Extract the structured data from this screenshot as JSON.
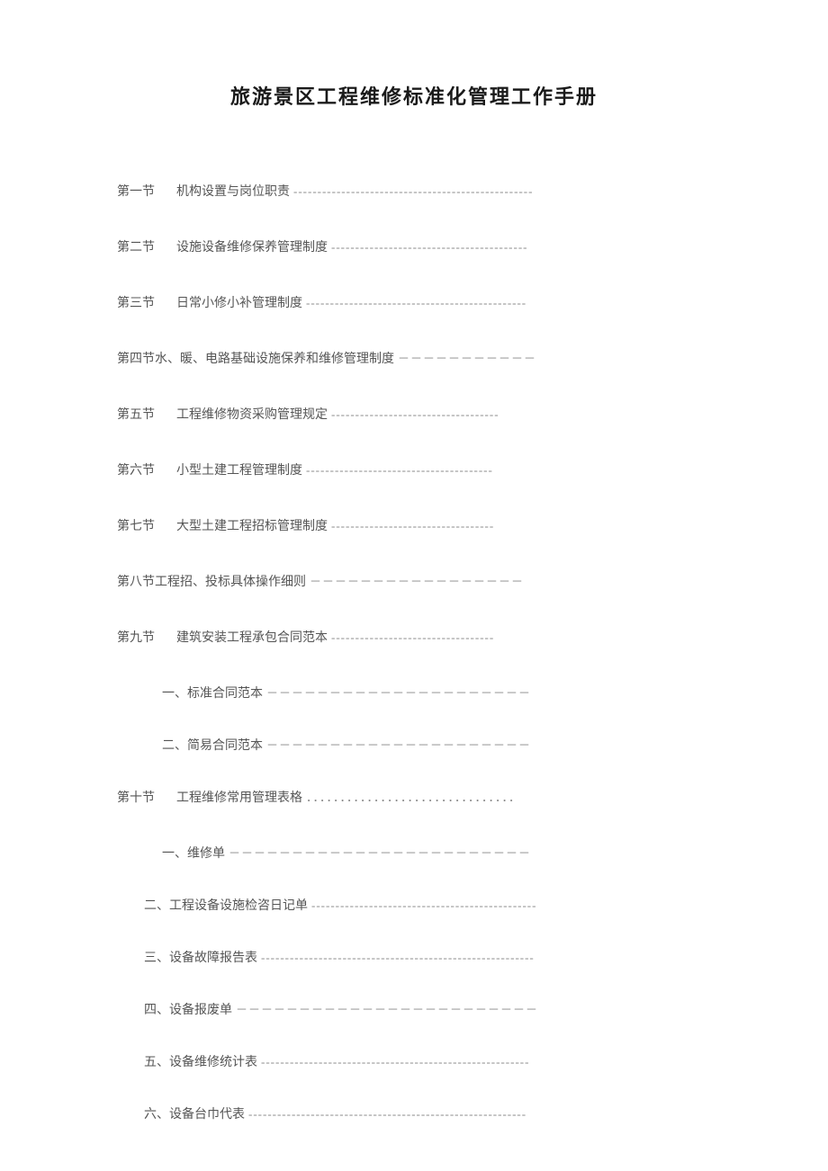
{
  "title": "旅游景区工程维修标准化管理工作手册",
  "toc": {
    "s1": {
      "label": "第一节",
      "text": "机构设置与岗位职责",
      "leader": "--------------------------------------------------"
    },
    "s2": {
      "label": "第二节",
      "text": "设施设备维修保养管理制度",
      "leader": "-----------------------------------------"
    },
    "s3": {
      "label": "第三节",
      "text": "日常小修小补管理制度",
      "leader": "----------------------------------------------"
    },
    "s4": {
      "label": "第四节",
      "text": "水、暖、电路基础设施保养和维修管理制度",
      "leader": "－－－－－－－－－－－"
    },
    "s5": {
      "label": "第五节",
      "text": "工程维修物资采购管理规定",
      "leader": "-----------------------------------"
    },
    "s6": {
      "label": "第六节",
      "text": "小型土建工程管理制度",
      "leader": "---------------------------------------"
    },
    "s7": {
      "label": "第七节",
      "text": "大型土建工程招标管理制度",
      "leader": "----------------------------------"
    },
    "s8": {
      "label": "第八节",
      "text": "工程招、投标具体操作细则",
      "leader": "－－－－－－－－－－－－－－－－－"
    },
    "s9": {
      "label": "第九节",
      "text": "建筑安装工程承包合同范本",
      "leader": "----------------------------------"
    },
    "s9a": {
      "text": "一、标准合同范本",
      "leader": "－－－－－－－－－－－－－－－－－－－－－"
    },
    "s9b": {
      "text": "二、简易合同范本",
      "leader": "－－－－－－－－－－－－－－－－－－－－－"
    },
    "s10": {
      "label": "第十节",
      "text": "工程维修常用管理表格",
      "leader": "．．．．．．．．．．．．．．．．．．．．．．．．．．．．．．．"
    },
    "s10a": {
      "text": "一、维修单",
      "leader": "－－－－－－－－－－－－－－－－－－－－－－－－"
    },
    "s10b": {
      "text": "二、工程设备设施检咨日记单",
      "leader": "-----------------------------------------------"
    },
    "s10c": {
      "text": "三、设备故障报告表",
      "leader": "---------------------------------------------------------"
    },
    "s10d": {
      "text": "四、设备报废单",
      "leader": "－－－－－－－－－－－－－－－－－－－－－－－－"
    },
    "s10e": {
      "text": "五、设备维修统计表",
      "leader": "--------------------------------------------------------"
    },
    "s10f": {
      "text": "六、设备台巾代表",
      "leader": "----------------------------------------------------------"
    }
  }
}
